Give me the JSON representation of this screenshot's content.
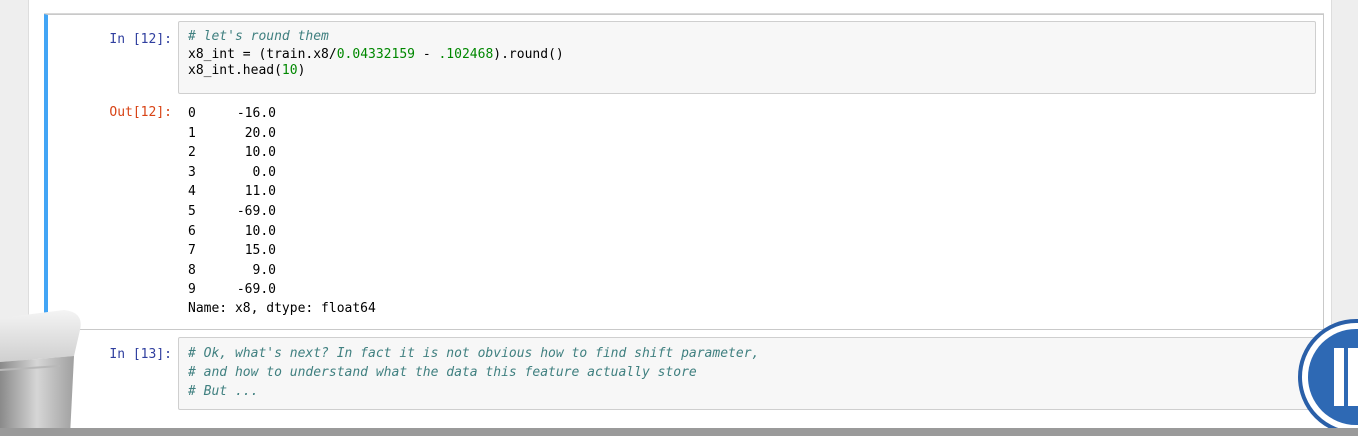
{
  "cell_12": {
    "in_prompt": "In [12]:",
    "code": {
      "line1_comment": "# let's round them",
      "line2_part1": "x8_int = (train.x8/",
      "line2_num1": "0.04332159",
      "line2_part2": " - ",
      "line2_num2": ".102468",
      "line2_part3": ").round()",
      "line3_part1": "x8_int.head(",
      "line3_num": "10",
      "line3_part2": ")"
    },
    "out_prompt": "Out[12]:",
    "output_rows": [
      {
        "index": "0",
        "value": "-16.0"
      },
      {
        "index": "1",
        "value": "20.0"
      },
      {
        "index": "2",
        "value": "10.0"
      },
      {
        "index": "3",
        "value": "0.0"
      },
      {
        "index": "4",
        "value": "11.0"
      },
      {
        "index": "5",
        "value": "-69.0"
      },
      {
        "index": "6",
        "value": "10.0"
      },
      {
        "index": "7",
        "value": "15.0"
      },
      {
        "index": "8",
        "value": "9.0"
      },
      {
        "index": "9",
        "value": "-69.0"
      }
    ],
    "output_footer": "Name: x8, dtype: float64"
  },
  "cell_13": {
    "in_prompt": "In [13]:",
    "lines": [
      "# Ok, what's next? In fact it is not obvious how to find shift parameter,",
      "# and how to understand what the data this feature actually store",
      "# But ..."
    ]
  },
  "colors": {
    "selected_cell_border": "#42a5f5",
    "in_prompt": "#303f9f",
    "out_prompt": "#d84315",
    "comment": "#408080",
    "number": "#008800"
  },
  "icons": {
    "logo": "university-logo-icon",
    "stand": "webcam-stand-icon"
  }
}
